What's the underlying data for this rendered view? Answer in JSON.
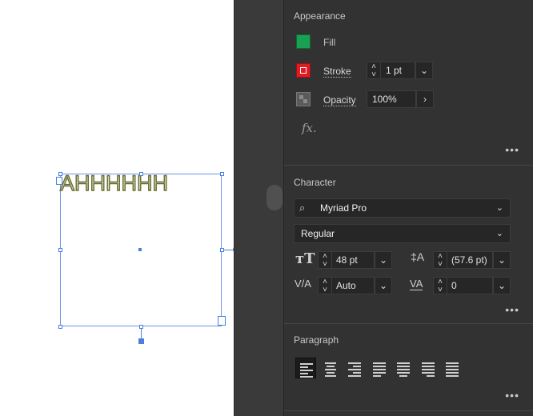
{
  "canvas": {
    "artwork_text": "AHHHHHH"
  },
  "colors": {
    "fill": "#1aa053",
    "stroke": "#e11b22",
    "selection": "#4a7fe0",
    "panel_bg": "#323232"
  },
  "appearance": {
    "title": "Appearance",
    "fill_label": "Fill",
    "stroke_label": "Stroke",
    "stroke_weight": "1 pt",
    "opacity_label": "Opacity",
    "opacity_value": "100%",
    "fx_label": "fx.",
    "more": "•••"
  },
  "character": {
    "title": "Character",
    "font_family": "Myriad Pro",
    "font_style": "Regular",
    "font_size": "48 pt",
    "leading": "(57.6 pt)",
    "kerning": "Auto",
    "tracking": "0",
    "more": "•••"
  },
  "paragraph": {
    "title": "Paragraph",
    "alignments": [
      {
        "icon": "align-left-icon",
        "active": true
      },
      {
        "icon": "align-center-icon",
        "active": false
      },
      {
        "icon": "align-right-icon",
        "active": false
      },
      {
        "icon": "justify-left-icon",
        "active": false
      },
      {
        "icon": "justify-center-icon",
        "active": false
      },
      {
        "icon": "justify-right-icon",
        "active": false
      },
      {
        "icon": "justify-all-icon",
        "active": false
      }
    ],
    "more": "•••"
  }
}
